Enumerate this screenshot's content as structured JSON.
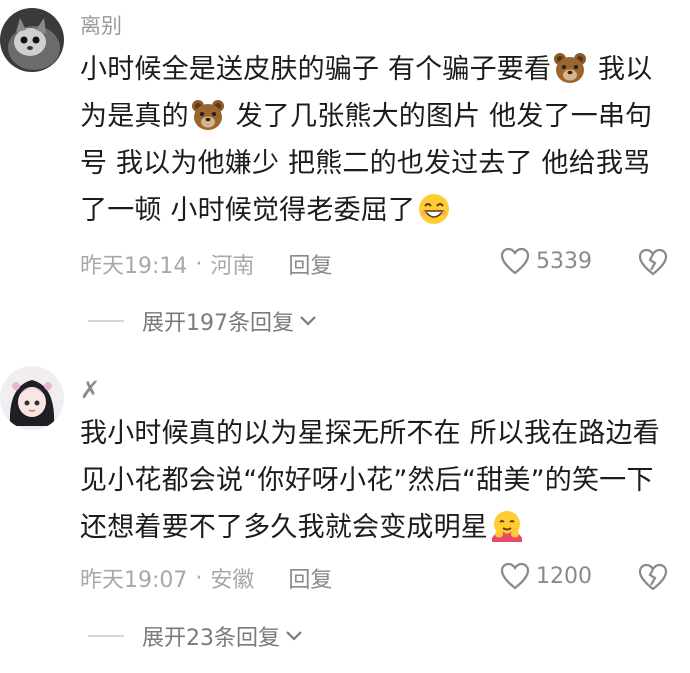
{
  "comments": [
    {
      "username": "离别",
      "text_parts": [
        "小时候全是送皮肤的骗子 有个骗子要看",
        " 我以为是真的",
        " 发了几张熊大的图片 他发了一串句号 我以为他嫌少 把熊二的也发过去了 他给我骂了一顿 小时候觉得老委屈了"
      ],
      "emojis": [
        "bear-emoji",
        "bear-emoji",
        "grin-emoji"
      ],
      "time": "昨天19:14",
      "location": "河南",
      "reply_label": "回复",
      "likes": "5339",
      "expand_label": "展开197条回复"
    },
    {
      "username": "✗",
      "text_parts": [
        "我小时候真的以为星探无所不在 所以我在路边看见小花都会说“你好呀小花”然后“甜美”的笑一下 还想着要不了多久我就会变成明星"
      ],
      "emojis": [
        "hug-emoji"
      ],
      "time": "昨天19:07",
      "location": "安徽",
      "reply_label": "回复",
      "likes": "1200",
      "expand_label": "展开23条回复"
    }
  ],
  "separator": "·",
  "colors": {
    "meta": "#a8a8a8",
    "text": "#1c1c1c",
    "divider": "#d6d6d6"
  }
}
